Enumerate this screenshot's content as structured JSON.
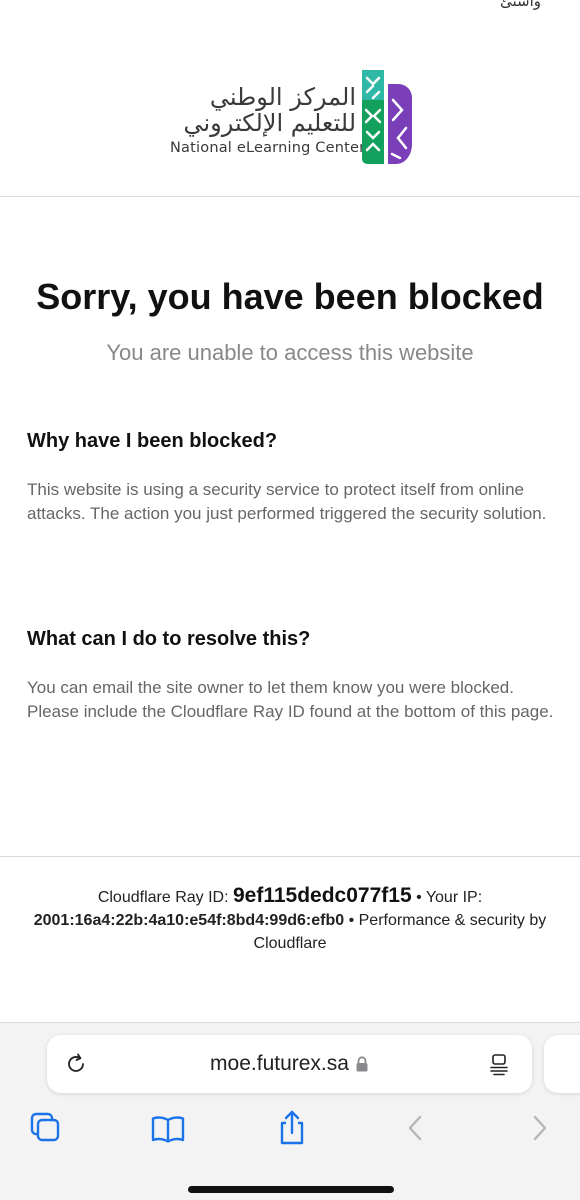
{
  "status_bar": {
    "fragment": "واستئ"
  },
  "header": {
    "logo_ar_line1": "المركز الوطني",
    "logo_ar_line2": "للتعليم الإلكتروني",
    "logo_en": "National eLearning Center"
  },
  "main": {
    "title": "Sorry, you have been blocked",
    "subtitle": "You are unable to access this website",
    "sections": [
      {
        "heading": "Why have I been blocked?",
        "body": "This website is using a security service to protect itself from online attacks. The action you just performed triggered the security solution."
      },
      {
        "heading": "What can I do to resolve this?",
        "body": "You can email the site owner to let them know you were blocked. Please include the Cloudflare Ray ID found at the bottom of this page."
      }
    ]
  },
  "footer": {
    "ray_label": "Cloudflare Ray ID: ",
    "ray_id": "9ef115dedc077f15",
    "sep1": " • ",
    "ip_label": "Your IP: ",
    "ip": "2001:16a4:22b:4a10:e54f:8bd4:99d6:efb0",
    "sep2": " • ",
    "perf": "Performance & security by Cloudflare"
  },
  "browser": {
    "url": "moe.futurex.sa",
    "icons": [
      "reload-icon",
      "lock-icon",
      "reader-mode-icon",
      "tabs-icon",
      "bookmarks-icon",
      "share-icon",
      "back-icon",
      "forward-icon"
    ],
    "accent_color": "#1a73e8",
    "disabled_color": "#b5b5b8"
  },
  "colors": {
    "logo_teal": "#2fb8a6",
    "logo_green": "#12a05c",
    "logo_purple": "#7a3fb8"
  }
}
